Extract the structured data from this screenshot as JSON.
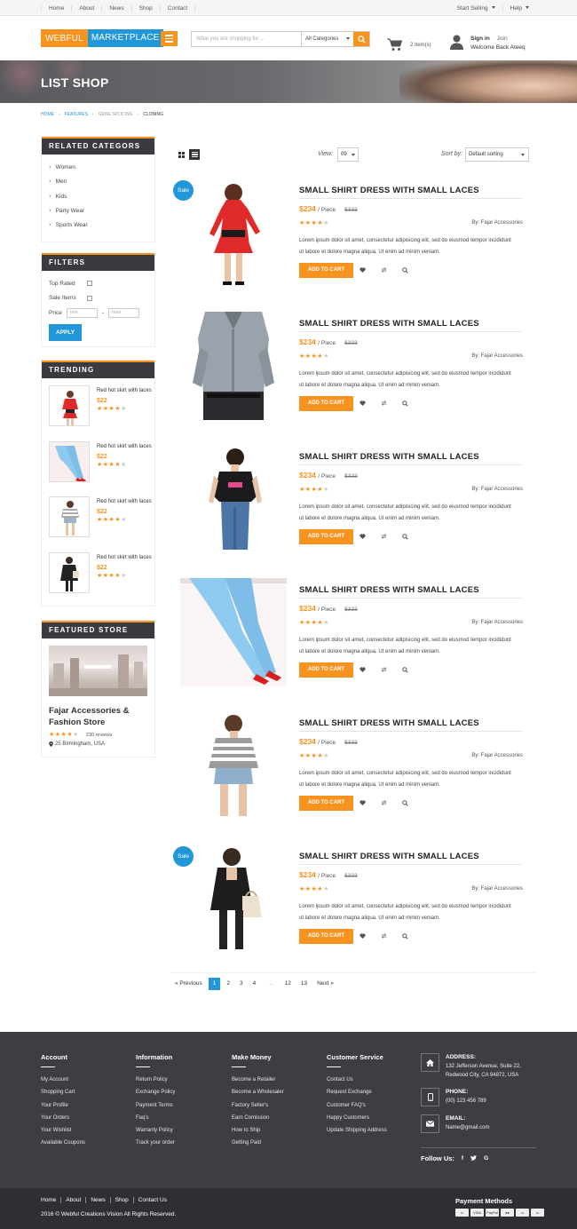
{
  "topbar": {
    "nav": [
      "Home",
      "About",
      "News",
      "Shop",
      "Contact"
    ],
    "start_selling": "Start Selling",
    "help": "Help"
  },
  "header": {
    "logo_part1": "WEBFUL",
    "logo_part2": "MARKETPLACE",
    "search_placeholder": "What you are shopping for ...",
    "category_select": "All Categories",
    "cart_count": "2 Item(s)",
    "sign_in": "Sign in",
    "join": "Join",
    "welcome": "Welcome Back Ateeq"
  },
  "banner": {
    "title": "LIST SHOP"
  },
  "breadcrumb": [
    "HOME",
    "FEATURES",
    "GENE SPLICING",
    "CLONING"
  ],
  "sidebar": {
    "categories_title": "RELATED CATEGORS",
    "categories": [
      "Women",
      "Men",
      "Kids",
      "Party Wear",
      "Sports Wear"
    ],
    "filters_title": "FILTERS",
    "top_rated": "Top Rated",
    "sale_items": "Sale Items",
    "price_label": "Price",
    "min_placeholder": "min",
    "price_separator": "-",
    "max_placeholder": "max",
    "apply": "APPLY",
    "trending_title": "TRENDING",
    "trending": [
      {
        "name": "Red hot skirt with laces",
        "price": "$22",
        "rating": 4
      },
      {
        "name": "Red hot skirt with laces",
        "price": "$22",
        "rating": 4
      },
      {
        "name": "Red hot skirt with laces",
        "price": "$22",
        "rating": 4
      },
      {
        "name": "Red hot skirt with laces",
        "price": "$22",
        "rating": 4
      }
    ],
    "featured_title": "FEATURED STORE",
    "store_name": "Fajar Accessories & Fashion Store",
    "store_rating": 4,
    "store_reviews": "230 reviews",
    "store_location": "25 Birmingham, USA"
  },
  "toolbar": {
    "view_label": "View:",
    "view_value": "09",
    "sort_label": "Sort by:",
    "sort_value": "Default sorting"
  },
  "products": [
    {
      "sale": "Sale",
      "title": "SMALL SHIRT DRESS WITH SMALL LACES",
      "price": "$234",
      "unit": "/ Piece",
      "old_price": "$333",
      "rating": 4,
      "by": "By: Fajar Accessories",
      "desc": "Lorem ipsum dolor sit amet, consectetur adipisicing elit, sed do eiusmod tempor incididunt ut labore et dolore magna aliqua. Ut enim ad minim veniam.",
      "add_to_cart": "ADD TO CART"
    },
    {
      "sale": "",
      "title": "SMALL SHIRT DRESS WITH SMALL LACES",
      "price": "$234",
      "unit": "/ Piece",
      "old_price": "$333",
      "rating": 4,
      "by": "By: Fajar Accessories",
      "desc": "Lorem ipsum dolor sit amet, consectetur adipisicing elit, sed do eiusmod tempor incididunt ut labore et dolore magna aliqua. Ut enim ad minim veniam.",
      "add_to_cart": "ADD TO CART"
    },
    {
      "sale": "",
      "title": "SMALL SHIRT DRESS WITH SMALL LACES",
      "price": "$234",
      "unit": "/ Piece",
      "old_price": "$333",
      "rating": 4,
      "by": "By: Fajar Accessories",
      "desc": "Lorem ipsum dolor sit amet, consectetur adipisicing elit, sed do eiusmod tempor incididunt ut labore et dolore magna aliqua. Ut enim ad minim veniam.",
      "add_to_cart": "ADD TO CART"
    },
    {
      "sale": "",
      "title": "SMALL SHIRT DRESS WITH SMALL LACES",
      "price": "$234",
      "unit": "/ Piece",
      "old_price": "$333",
      "rating": 4,
      "by": "By: Fajar Accessories",
      "desc": "Lorem ipsum dolor sit amet, consectetur adipisicing elit, sed do eiusmod tempor incididunt ut labore et dolore magna aliqua. Ut enim ad minim veniam.",
      "add_to_cart": "ADD TO CART"
    },
    {
      "sale": "",
      "title": "SMALL SHIRT DRESS WITH SMALL LACES",
      "price": "$234",
      "unit": "/ Piece",
      "old_price": "$333",
      "rating": 4,
      "by": "By: Fajar Accessories",
      "desc": "Lorem ipsum dolor sit amet, consectetur adipisicing elit, sed do eiusmod tempor incididunt ut labore et dolore magna aliqua. Ut enim ad minim veniam.",
      "add_to_cart": "ADD TO CART"
    },
    {
      "sale": "Sale",
      "title": "SMALL SHIRT DRESS WITH SMALL LACES",
      "price": "$234",
      "unit": "/ Piece",
      "old_price": "$333",
      "rating": 4,
      "by": "By: Fajar Accessories",
      "desc": "Lorem ipsum dolor sit amet, consectetur adipisicing elit, sed do eiusmod tempor incididunt ut labore et dolore magna aliqua. Ut enim ad minim veniam.",
      "add_to_cart": "ADD TO CART"
    }
  ],
  "pagination": {
    "previous": "« Previous",
    "pages": [
      "1",
      "2",
      "3",
      "4",
      "...",
      "12",
      "13"
    ],
    "active": "1",
    "next": "Next »"
  },
  "footer": {
    "columns": [
      {
        "title": "Account",
        "links": [
          "My Account",
          "Shopping Cart",
          "Your Profile",
          "Your Orders",
          "Your Wishlist",
          "Available Coupons"
        ]
      },
      {
        "title": "Information",
        "links": [
          "Return Policy",
          "Exchange Policy",
          "Payment Terms",
          "Faq's",
          "Warranty Policy",
          "Track your order"
        ]
      },
      {
        "title": "Make Money",
        "links": [
          "Become a Retailer",
          "Become a Wholesaler",
          "Factory Seller's",
          "Earn Comission",
          "How to Ship",
          "Getting Paid"
        ]
      },
      {
        "title": "Customer Service",
        "links": [
          "Contact Us",
          "Request Exchange",
          "Customer FAQ's",
          "Happy Customers",
          "Update Shipping Address"
        ]
      }
    ],
    "address_label": "ADDRESS:",
    "address": "132 Jefferson Avenue, Suite 22, Redwood City, CA 94872, USA",
    "phone_label": "PHONE:",
    "phone": "(00) 123 456 789",
    "email_label": "EMAIL:",
    "email": "Name@gmail.com",
    "follow": "Follow Us:",
    "bottom_links": [
      "Home",
      "About",
      "News",
      "Shop",
      "Contact Us"
    ],
    "copyright": "2016 © Webful Creations Vision All Rights Reserved.",
    "payment_label": "Payment Methods",
    "payment_icons": [
      "card-icon",
      "VISA",
      "PayPal",
      "mastercard-icon",
      "card-icon",
      "card-icon"
    ]
  },
  "colors": {
    "accent": "#f7931e",
    "primary": "#2196d8",
    "dark": "#3a3b40",
    "footer": "#3d3e43"
  }
}
